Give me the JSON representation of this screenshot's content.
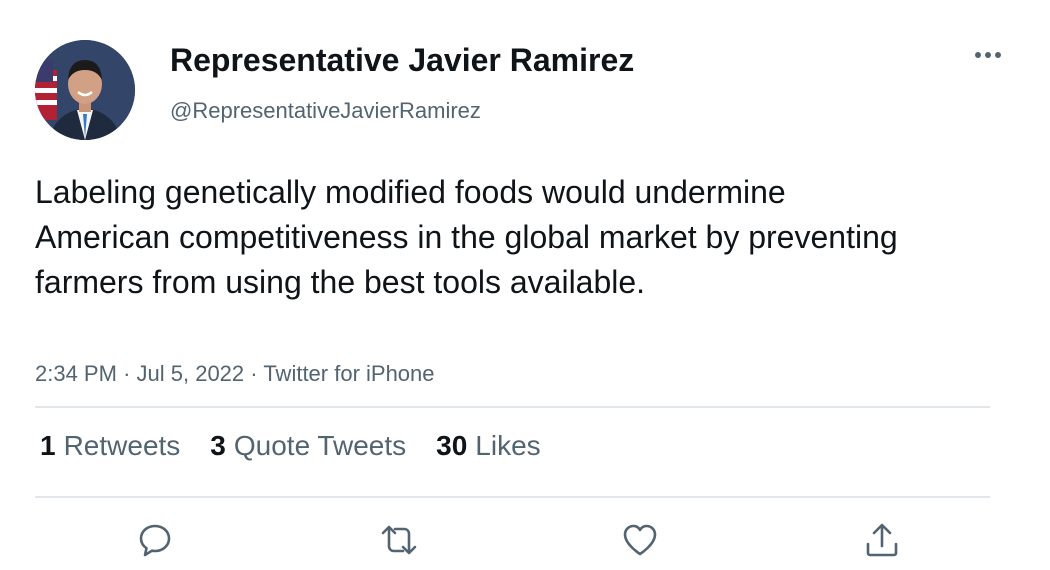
{
  "author": {
    "display_name": "Representative Javier Ramirez",
    "handle": "@RepresentativeJavierRamirez"
  },
  "tweet": {
    "text": "Labeling genetically modified foods would undermine American competitiveness in the global market by preventing farmers from using the best tools available.",
    "time": "2:34 PM",
    "separator": "·",
    "date": "Jul 5, 2022",
    "source": "Twitter for iPhone"
  },
  "stats": {
    "retweets_count": "1",
    "retweets_label": "Retweets",
    "quotes_count": "3",
    "quotes_label": "Quote Tweets",
    "likes_count": "30",
    "likes_label": "Likes"
  },
  "icons": {
    "more": "more-horizontal-icon",
    "reply": "reply-icon",
    "retweet": "retweet-icon",
    "like": "heart-icon",
    "share": "share-icon"
  },
  "colors": {
    "text_primary": "#0f1419",
    "text_secondary": "#536471",
    "divider": "#e1e6ea",
    "icon": "#536471"
  }
}
